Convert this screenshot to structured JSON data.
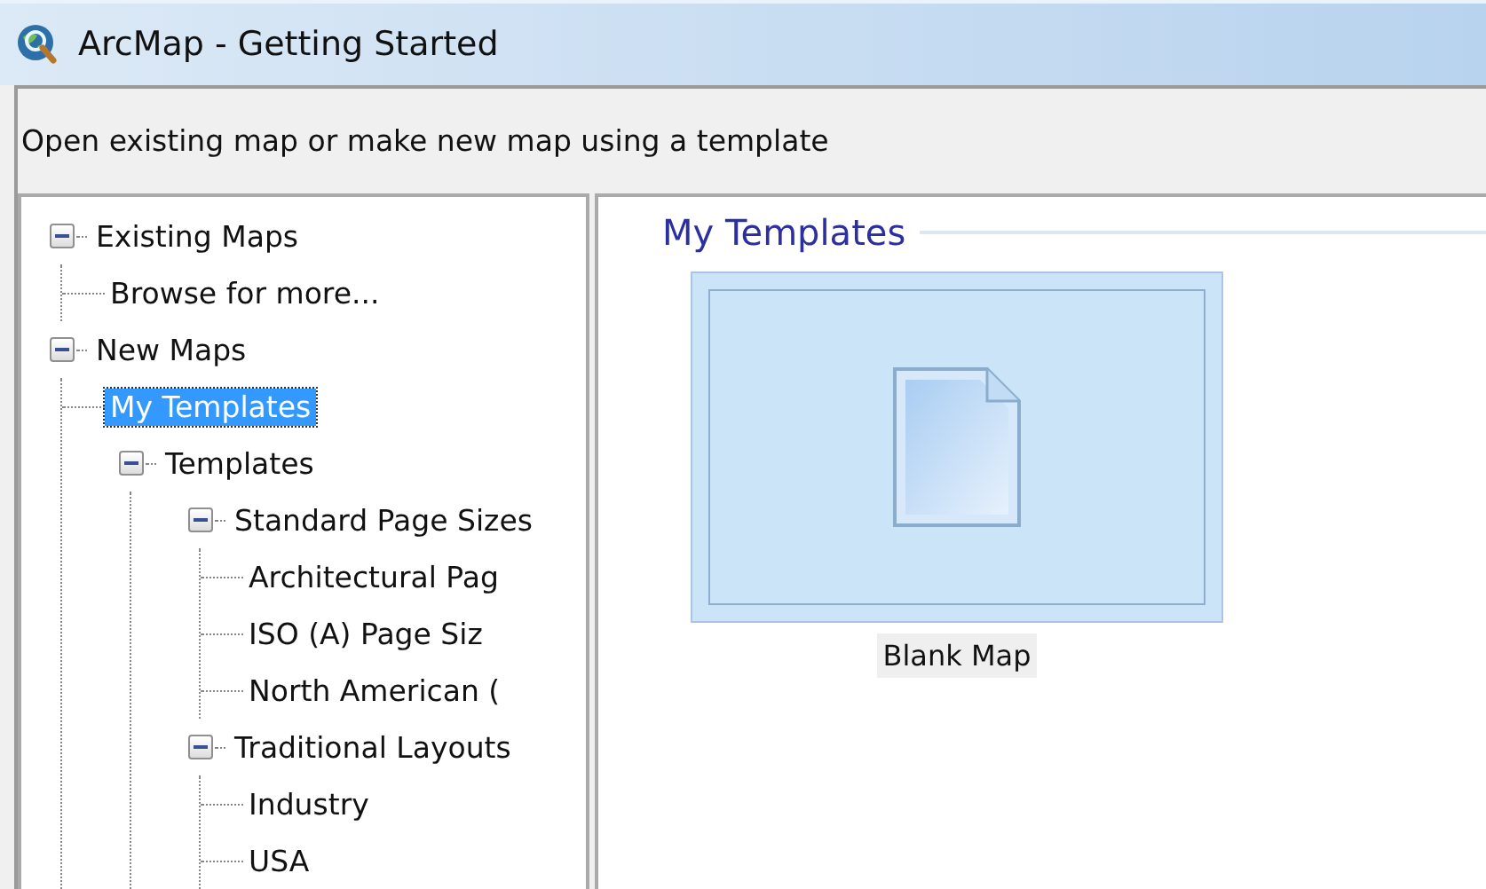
{
  "window": {
    "title": "ArcMap - Getting Started"
  },
  "instruction": "Open existing map or make new map using a template",
  "tree": [
    {
      "label": "Existing Maps",
      "expanded": true,
      "selected": false,
      "children": [
        {
          "label": "Browse for more...",
          "selected": false
        }
      ]
    },
    {
      "label": "New Maps",
      "expanded": true,
      "selected": false,
      "children": [
        {
          "label": "My Templates",
          "selected": true
        },
        {
          "label": "Templates",
          "expanded": true,
          "selected": false,
          "children": [
            {
              "label": "Standard Page Sizes",
              "expanded": true,
              "selected": false,
              "children": [
                {
                  "label": "Architectural Pag",
                  "selected": false
                },
                {
                  "label": "ISO (A) Page Siz",
                  "selected": false
                },
                {
                  "label": "North American (",
                  "selected": false
                }
              ]
            },
            {
              "label": "Traditional Layouts",
              "expanded": true,
              "selected": false,
              "children": [
                {
                  "label": "Industry",
                  "selected": false
                },
                {
                  "label": "USA",
                  "selected": false
                }
              ]
            }
          ]
        }
      ]
    }
  ],
  "gallery": {
    "heading": "My Templates",
    "items": [
      {
        "label": "Blank Map",
        "selected": true
      }
    ]
  }
}
